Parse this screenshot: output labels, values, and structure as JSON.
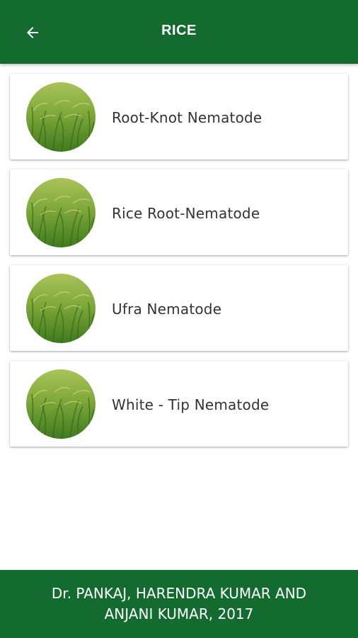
{
  "appbar": {
    "title": "RICE",
    "back_icon": "arrow-left-icon",
    "background_color": "#146b30"
  },
  "items": [
    {
      "label": "Root-Knot Nematode",
      "icon": "rice-field-image"
    },
    {
      "label": "Rice Root-Nematode",
      "icon": "rice-field-image"
    },
    {
      "label": "Ufra Nematode",
      "icon": "rice-field-image"
    },
    {
      "label": "White - Tip Nematode",
      "icon": "rice-field-image"
    }
  ],
  "footer": {
    "line1": "Dr. PANKAJ, HARENDRA KUMAR AND",
    "line2": "ANJANI KUMAR, 2017"
  }
}
